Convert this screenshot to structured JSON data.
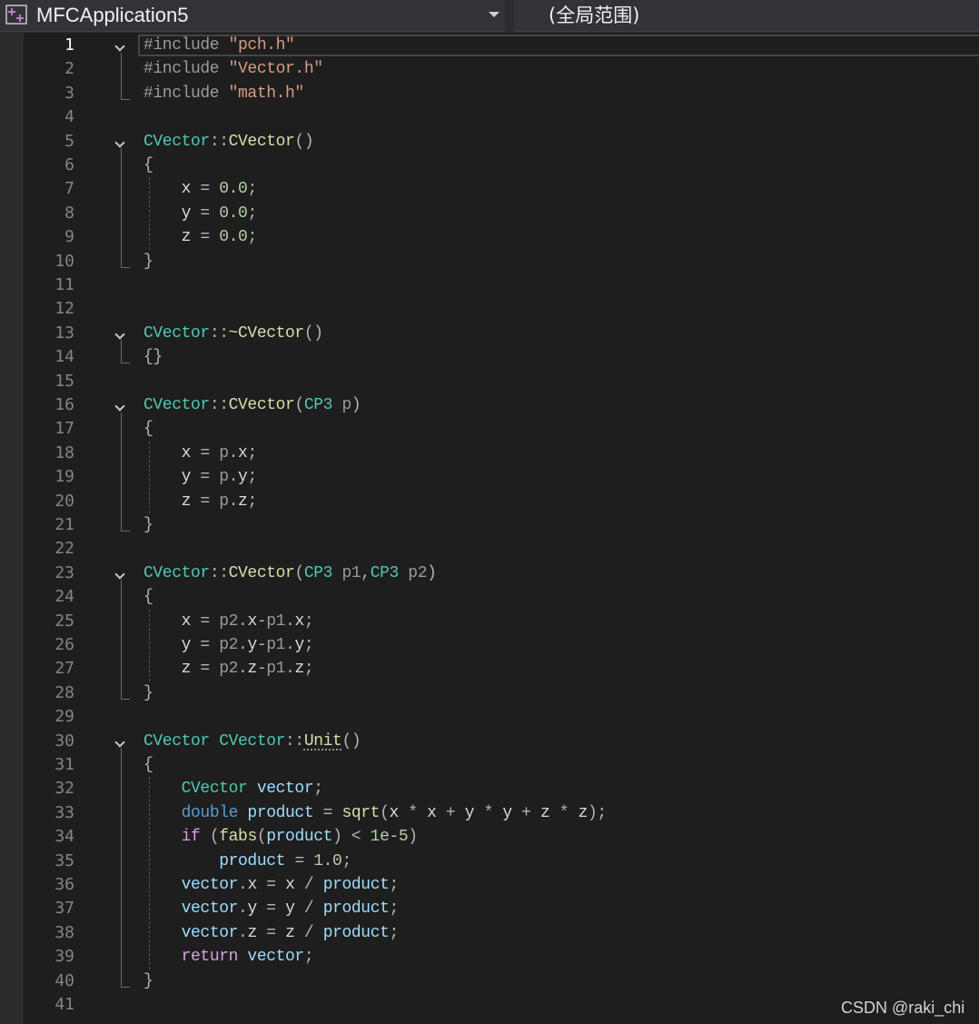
{
  "navbar": {
    "project_icon": "cpp-project-icon",
    "project_name": "MFCApplication5",
    "scope_name": "(全局范围)"
  },
  "editor": {
    "current_line": 1,
    "folded_regions": [
      {
        "start": 1,
        "end": 3
      },
      {
        "start": 5,
        "end": 10
      },
      {
        "start": 13,
        "end": 14
      },
      {
        "start": 16,
        "end": 21
      },
      {
        "start": 23,
        "end": 28
      },
      {
        "start": 30,
        "end": 40
      }
    ],
    "lines": [
      {
        "n": "1",
        "tokens": [
          [
            "t-pp",
            "#include "
          ],
          [
            "t-str",
            "\"pch.h\""
          ]
        ]
      },
      {
        "n": "2",
        "tokens": [
          [
            "t-pp",
            "#include "
          ],
          [
            "t-str",
            "\"Vector.h\""
          ]
        ]
      },
      {
        "n": "3",
        "tokens": [
          [
            "t-pp",
            "#include "
          ],
          [
            "t-str",
            "\"math.h\""
          ]
        ]
      },
      {
        "n": "4",
        "tokens": []
      },
      {
        "n": "5",
        "tokens": [
          [
            "t-type",
            "CVector"
          ],
          [
            "t-op",
            "::"
          ],
          [
            "t-fn",
            "CVector"
          ],
          [
            "t-op",
            "()"
          ]
        ]
      },
      {
        "n": "6",
        "tokens": [
          [
            "t-op",
            "{"
          ]
        ]
      },
      {
        "n": "7",
        "tokens": [
          [
            "t-var",
            "    x "
          ],
          [
            "t-op",
            "= "
          ],
          [
            "t-num",
            "0.0"
          ],
          [
            "t-op",
            ";"
          ]
        ]
      },
      {
        "n": "8",
        "tokens": [
          [
            "t-var",
            "    y "
          ],
          [
            "t-op",
            "= "
          ],
          [
            "t-num",
            "0.0"
          ],
          [
            "t-op",
            ";"
          ]
        ]
      },
      {
        "n": "9",
        "tokens": [
          [
            "t-var",
            "    z "
          ],
          [
            "t-op",
            "= "
          ],
          [
            "t-num",
            "0.0"
          ],
          [
            "t-op",
            ";"
          ]
        ]
      },
      {
        "n": "10",
        "tokens": [
          [
            "t-op",
            "}"
          ]
        ]
      },
      {
        "n": "11",
        "tokens": []
      },
      {
        "n": "12",
        "tokens": []
      },
      {
        "n": "13",
        "tokens": [
          [
            "t-type",
            "CVector"
          ],
          [
            "t-op",
            "::"
          ],
          [
            "t-fn",
            "~CVector"
          ],
          [
            "t-op",
            "()"
          ]
        ]
      },
      {
        "n": "14",
        "tokens": [
          [
            "t-op",
            "{}"
          ]
        ]
      },
      {
        "n": "15",
        "tokens": []
      },
      {
        "n": "16",
        "tokens": [
          [
            "t-type",
            "CVector"
          ],
          [
            "t-op",
            "::"
          ],
          [
            "t-fn",
            "CVector"
          ],
          [
            "t-op",
            "("
          ],
          [
            "t-type",
            "CP3"
          ],
          [
            "t-param",
            " p"
          ],
          [
            "t-op",
            ")"
          ]
        ]
      },
      {
        "n": "17",
        "tokens": [
          [
            "t-op",
            "{"
          ]
        ]
      },
      {
        "n": "18",
        "tokens": [
          [
            "t-var",
            "    x "
          ],
          [
            "t-op",
            "= "
          ],
          [
            "t-param",
            "p"
          ],
          [
            "t-op",
            "."
          ],
          [
            "t-var",
            "x"
          ],
          [
            "t-op",
            ";"
          ]
        ]
      },
      {
        "n": "19",
        "tokens": [
          [
            "t-var",
            "    y "
          ],
          [
            "t-op",
            "= "
          ],
          [
            "t-param",
            "p"
          ],
          [
            "t-op",
            "."
          ],
          [
            "t-var",
            "y"
          ],
          [
            "t-op",
            ";"
          ]
        ]
      },
      {
        "n": "20",
        "tokens": [
          [
            "t-var",
            "    z "
          ],
          [
            "t-op",
            "= "
          ],
          [
            "t-param",
            "p"
          ],
          [
            "t-op",
            "."
          ],
          [
            "t-var",
            "z"
          ],
          [
            "t-op",
            ";"
          ]
        ]
      },
      {
        "n": "21",
        "tokens": [
          [
            "t-op",
            "}"
          ]
        ]
      },
      {
        "n": "22",
        "tokens": []
      },
      {
        "n": "23",
        "tokens": [
          [
            "t-type",
            "CVector"
          ],
          [
            "t-op",
            "::"
          ],
          [
            "t-fn",
            "CVector"
          ],
          [
            "t-op",
            "("
          ],
          [
            "t-type",
            "CP3"
          ],
          [
            "t-param",
            " p1"
          ],
          [
            "t-op",
            ","
          ],
          [
            "t-type",
            "CP3"
          ],
          [
            "t-param",
            " p2"
          ],
          [
            "t-op",
            ")"
          ]
        ]
      },
      {
        "n": "24",
        "tokens": [
          [
            "t-op",
            "{"
          ]
        ]
      },
      {
        "n": "25",
        "tokens": [
          [
            "t-var",
            "    x "
          ],
          [
            "t-op",
            "= "
          ],
          [
            "t-param",
            "p2"
          ],
          [
            "t-op",
            "."
          ],
          [
            "t-var",
            "x"
          ],
          [
            "t-op",
            "-"
          ],
          [
            "t-param",
            "p1"
          ],
          [
            "t-op",
            "."
          ],
          [
            "t-var",
            "x"
          ],
          [
            "t-op",
            ";"
          ]
        ]
      },
      {
        "n": "26",
        "tokens": [
          [
            "t-var",
            "    y "
          ],
          [
            "t-op",
            "= "
          ],
          [
            "t-param",
            "p2"
          ],
          [
            "t-op",
            "."
          ],
          [
            "t-var",
            "y"
          ],
          [
            "t-op",
            "-"
          ],
          [
            "t-param",
            "p1"
          ],
          [
            "t-op",
            "."
          ],
          [
            "t-var",
            "y"
          ],
          [
            "t-op",
            ";"
          ]
        ]
      },
      {
        "n": "27",
        "tokens": [
          [
            "t-var",
            "    z "
          ],
          [
            "t-op",
            "= "
          ],
          [
            "t-param",
            "p2"
          ],
          [
            "t-op",
            "."
          ],
          [
            "t-var",
            "z"
          ],
          [
            "t-op",
            "-"
          ],
          [
            "t-param",
            "p1"
          ],
          [
            "t-op",
            "."
          ],
          [
            "t-var",
            "z"
          ],
          [
            "t-op",
            ";"
          ]
        ]
      },
      {
        "n": "28",
        "tokens": [
          [
            "t-op",
            "}"
          ]
        ]
      },
      {
        "n": "29",
        "tokens": []
      },
      {
        "n": "30",
        "tokens": [
          [
            "t-type",
            "CVector "
          ],
          [
            "t-type",
            "CVector"
          ],
          [
            "t-op",
            "::"
          ],
          [
            "t-fn squiggle",
            "Unit"
          ],
          [
            "t-op",
            "()"
          ]
        ]
      },
      {
        "n": "31",
        "tokens": [
          [
            "t-op",
            "{"
          ]
        ]
      },
      {
        "n": "32",
        "tokens": [
          [
            "t-var",
            "    "
          ],
          [
            "t-type",
            "CVector "
          ],
          [
            "t-loc",
            "vector"
          ],
          [
            "t-op",
            ";"
          ]
        ]
      },
      {
        "n": "33",
        "tokens": [
          [
            "t-var",
            "    "
          ],
          [
            "t-kw",
            "double "
          ],
          [
            "t-loc",
            "product "
          ],
          [
            "t-op",
            "= "
          ],
          [
            "t-fn",
            "sqrt"
          ],
          [
            "t-op",
            "("
          ],
          [
            "t-var",
            "x "
          ],
          [
            "t-op",
            "* "
          ],
          [
            "t-var",
            "x "
          ],
          [
            "t-op",
            "+ "
          ],
          [
            "t-var",
            "y "
          ],
          [
            "t-op",
            "* "
          ],
          [
            "t-var",
            "y "
          ],
          [
            "t-op",
            "+ "
          ],
          [
            "t-var",
            "z "
          ],
          [
            "t-op",
            "* "
          ],
          [
            "t-var",
            "z"
          ],
          [
            "t-op",
            ");"
          ]
        ]
      },
      {
        "n": "34",
        "tokens": [
          [
            "t-var",
            "    "
          ],
          [
            "t-ctl",
            "if "
          ],
          [
            "t-op",
            "("
          ],
          [
            "t-fn",
            "fabs"
          ],
          [
            "t-op",
            "("
          ],
          [
            "t-loc",
            "product"
          ],
          [
            "t-op",
            ") < "
          ],
          [
            "t-num",
            "1e-5"
          ],
          [
            "t-op",
            ")"
          ]
        ]
      },
      {
        "n": "35",
        "tokens": [
          [
            "t-var",
            "        "
          ],
          [
            "t-loc",
            "product "
          ],
          [
            "t-op",
            "= "
          ],
          [
            "t-num",
            "1.0"
          ],
          [
            "t-op",
            ";"
          ]
        ]
      },
      {
        "n": "36",
        "tokens": [
          [
            "t-var",
            "    "
          ],
          [
            "t-loc",
            "vector"
          ],
          [
            "t-op",
            "."
          ],
          [
            "t-var",
            "x "
          ],
          [
            "t-op",
            "= "
          ],
          [
            "t-var",
            "x "
          ],
          [
            "t-op",
            "/ "
          ],
          [
            "t-loc",
            "product"
          ],
          [
            "t-op",
            ";"
          ]
        ]
      },
      {
        "n": "37",
        "tokens": [
          [
            "t-var",
            "    "
          ],
          [
            "t-loc",
            "vector"
          ],
          [
            "t-op",
            "."
          ],
          [
            "t-var",
            "y "
          ],
          [
            "t-op",
            "= "
          ],
          [
            "t-var",
            "y "
          ],
          [
            "t-op",
            "/ "
          ],
          [
            "t-loc",
            "product"
          ],
          [
            "t-op",
            ";"
          ]
        ]
      },
      {
        "n": "38",
        "tokens": [
          [
            "t-var",
            "    "
          ],
          [
            "t-loc",
            "vector"
          ],
          [
            "t-op",
            "."
          ],
          [
            "t-var",
            "z "
          ],
          [
            "t-op",
            "= "
          ],
          [
            "t-var",
            "z "
          ],
          [
            "t-op",
            "/ "
          ],
          [
            "t-loc",
            "product"
          ],
          [
            "t-op",
            ";"
          ]
        ]
      },
      {
        "n": "39",
        "tokens": [
          [
            "t-var",
            "    "
          ],
          [
            "t-ctl",
            "return "
          ],
          [
            "t-loc",
            "vector"
          ],
          [
            "t-op",
            ";"
          ]
        ]
      },
      {
        "n": "40",
        "tokens": [
          [
            "t-op",
            "}"
          ]
        ]
      },
      {
        "n": "41",
        "tokens": []
      }
    ]
  },
  "watermark": "CSDN @raki_chi",
  "theme_colors": {
    "background": "#1e1e1e",
    "type": "#4ec9b0",
    "function": "#dcdcaa",
    "keyword": "#569cd6",
    "control": "#d8a0df",
    "string": "#d69d85",
    "number": "#b5cea8",
    "local": "#9cdcfe"
  }
}
